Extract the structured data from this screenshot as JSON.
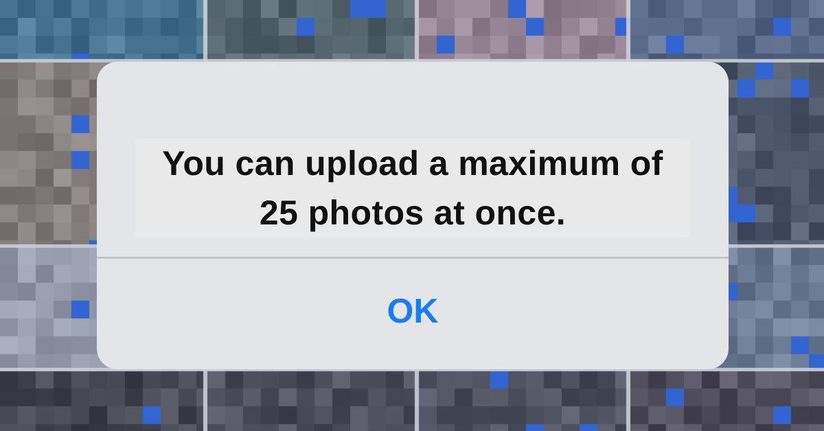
{
  "alert": {
    "message": "You can upload a maximum of 25 photos at once.",
    "ok_label": "OK"
  },
  "colors": {
    "dialog_background": "#e4e5e8",
    "button_text": "#1a7cf2",
    "message_text": "#111111",
    "divider": "#c3c4c7"
  }
}
